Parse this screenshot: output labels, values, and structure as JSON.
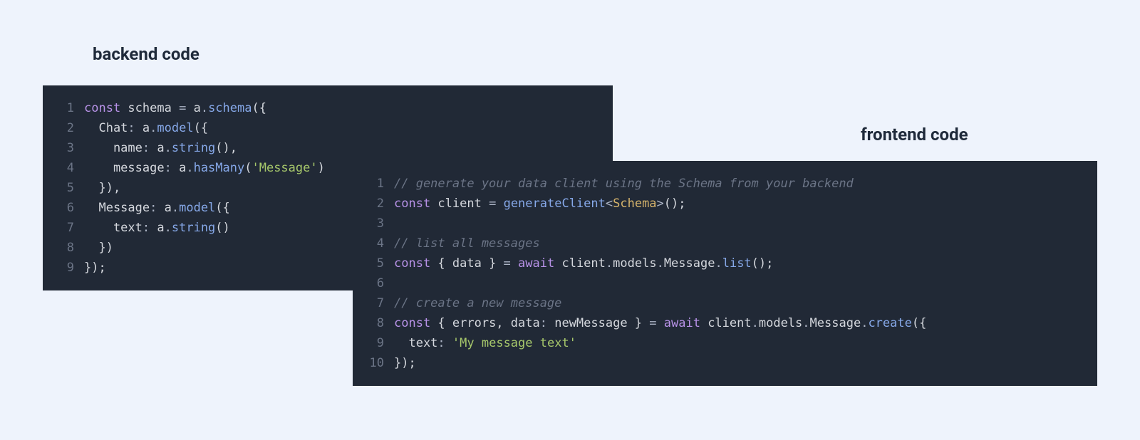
{
  "headings": {
    "backend": "backend code",
    "frontend": "frontend code"
  },
  "colors": {
    "pageBg": "#eef3fc",
    "codeBg": "#212936",
    "keyword": "#b892e8",
    "default": "#d4d7dd",
    "method": "#86a8e8",
    "string": "#a6c76b",
    "comment": "#6b7486",
    "type": "#d6b46c"
  },
  "backend": {
    "lines": [
      [
        {
          "t": "const",
          "c": "keyword"
        },
        {
          "t": " schema ",
          "c": "default"
        },
        {
          "t": "=",
          "c": "op"
        },
        {
          "t": " a",
          "c": "default"
        },
        {
          "t": ".",
          "c": "op"
        },
        {
          "t": "schema",
          "c": "method"
        },
        {
          "t": "({",
          "c": "default"
        }
      ],
      [
        {
          "t": "  Chat",
          "c": "default"
        },
        {
          "t": ":",
          "c": "op"
        },
        {
          "t": " a",
          "c": "default"
        },
        {
          "t": ".",
          "c": "op"
        },
        {
          "t": "model",
          "c": "method"
        },
        {
          "t": "({",
          "c": "default"
        }
      ],
      [
        {
          "t": "    name",
          "c": "default"
        },
        {
          "t": ":",
          "c": "op"
        },
        {
          "t": " a",
          "c": "default"
        },
        {
          "t": ".",
          "c": "op"
        },
        {
          "t": "string",
          "c": "method"
        },
        {
          "t": "(),",
          "c": "default"
        }
      ],
      [
        {
          "t": "    message",
          "c": "default"
        },
        {
          "t": ":",
          "c": "op"
        },
        {
          "t": " a",
          "c": "default"
        },
        {
          "t": ".",
          "c": "op"
        },
        {
          "t": "hasMany",
          "c": "method"
        },
        {
          "t": "(",
          "c": "default"
        },
        {
          "t": "'Message'",
          "c": "string"
        },
        {
          "t": ")",
          "c": "default"
        }
      ],
      [
        {
          "t": "  }),",
          "c": "default"
        }
      ],
      [
        {
          "t": "  Message",
          "c": "default"
        },
        {
          "t": ":",
          "c": "op"
        },
        {
          "t": " a",
          "c": "default"
        },
        {
          "t": ".",
          "c": "op"
        },
        {
          "t": "model",
          "c": "method"
        },
        {
          "t": "({",
          "c": "default"
        }
      ],
      [
        {
          "t": "    text",
          "c": "default"
        },
        {
          "t": ":",
          "c": "op"
        },
        {
          "t": " a",
          "c": "default"
        },
        {
          "t": ".",
          "c": "op"
        },
        {
          "t": "string",
          "c": "method"
        },
        {
          "t": "()",
          "c": "default"
        }
      ],
      [
        {
          "t": "  })",
          "c": "default"
        }
      ],
      [
        {
          "t": "});",
          "c": "default"
        }
      ]
    ]
  },
  "frontend": {
    "lines": [
      [
        {
          "t": "// generate your data client using the Schema from your backend",
          "c": "comment"
        }
      ],
      [
        {
          "t": "const",
          "c": "keyword"
        },
        {
          "t": " client ",
          "c": "default"
        },
        {
          "t": "=",
          "c": "op"
        },
        {
          "t": " ",
          "c": "default"
        },
        {
          "t": "generateClient",
          "c": "fn"
        },
        {
          "t": "<",
          "c": "op"
        },
        {
          "t": "Schema",
          "c": "type"
        },
        {
          "t": ">",
          "c": "op"
        },
        {
          "t": "();",
          "c": "default"
        }
      ],
      [
        {
          "t": "",
          "c": "default"
        }
      ],
      [
        {
          "t": "// list all messages",
          "c": "comment"
        }
      ],
      [
        {
          "t": "const",
          "c": "keyword"
        },
        {
          "t": " { data } ",
          "c": "default"
        },
        {
          "t": "=",
          "c": "op"
        },
        {
          "t": " ",
          "c": "default"
        },
        {
          "t": "await",
          "c": "keyword"
        },
        {
          "t": " client",
          "c": "default"
        },
        {
          "t": ".",
          "c": "op"
        },
        {
          "t": "models",
          "c": "default"
        },
        {
          "t": ".",
          "c": "op"
        },
        {
          "t": "Message",
          "c": "default"
        },
        {
          "t": ".",
          "c": "op"
        },
        {
          "t": "list",
          "c": "method"
        },
        {
          "t": "();",
          "c": "default"
        }
      ],
      [
        {
          "t": "",
          "c": "default"
        }
      ],
      [
        {
          "t": "// create a new message",
          "c": "comment"
        }
      ],
      [
        {
          "t": "const",
          "c": "keyword"
        },
        {
          "t": " { errors, data",
          "c": "default"
        },
        {
          "t": ":",
          "c": "op"
        },
        {
          "t": " newMessage } ",
          "c": "default"
        },
        {
          "t": "=",
          "c": "op"
        },
        {
          "t": " ",
          "c": "default"
        },
        {
          "t": "await",
          "c": "keyword"
        },
        {
          "t": " client",
          "c": "default"
        },
        {
          "t": ".",
          "c": "op"
        },
        {
          "t": "models",
          "c": "default"
        },
        {
          "t": ".",
          "c": "op"
        },
        {
          "t": "Message",
          "c": "default"
        },
        {
          "t": ".",
          "c": "op"
        },
        {
          "t": "create",
          "c": "method"
        },
        {
          "t": "({",
          "c": "default"
        }
      ],
      [
        {
          "t": "  text",
          "c": "default"
        },
        {
          "t": ":",
          "c": "op"
        },
        {
          "t": " ",
          "c": "default"
        },
        {
          "t": "'My message text'",
          "c": "string"
        }
      ],
      [
        {
          "t": "});",
          "c": "default"
        }
      ]
    ]
  }
}
